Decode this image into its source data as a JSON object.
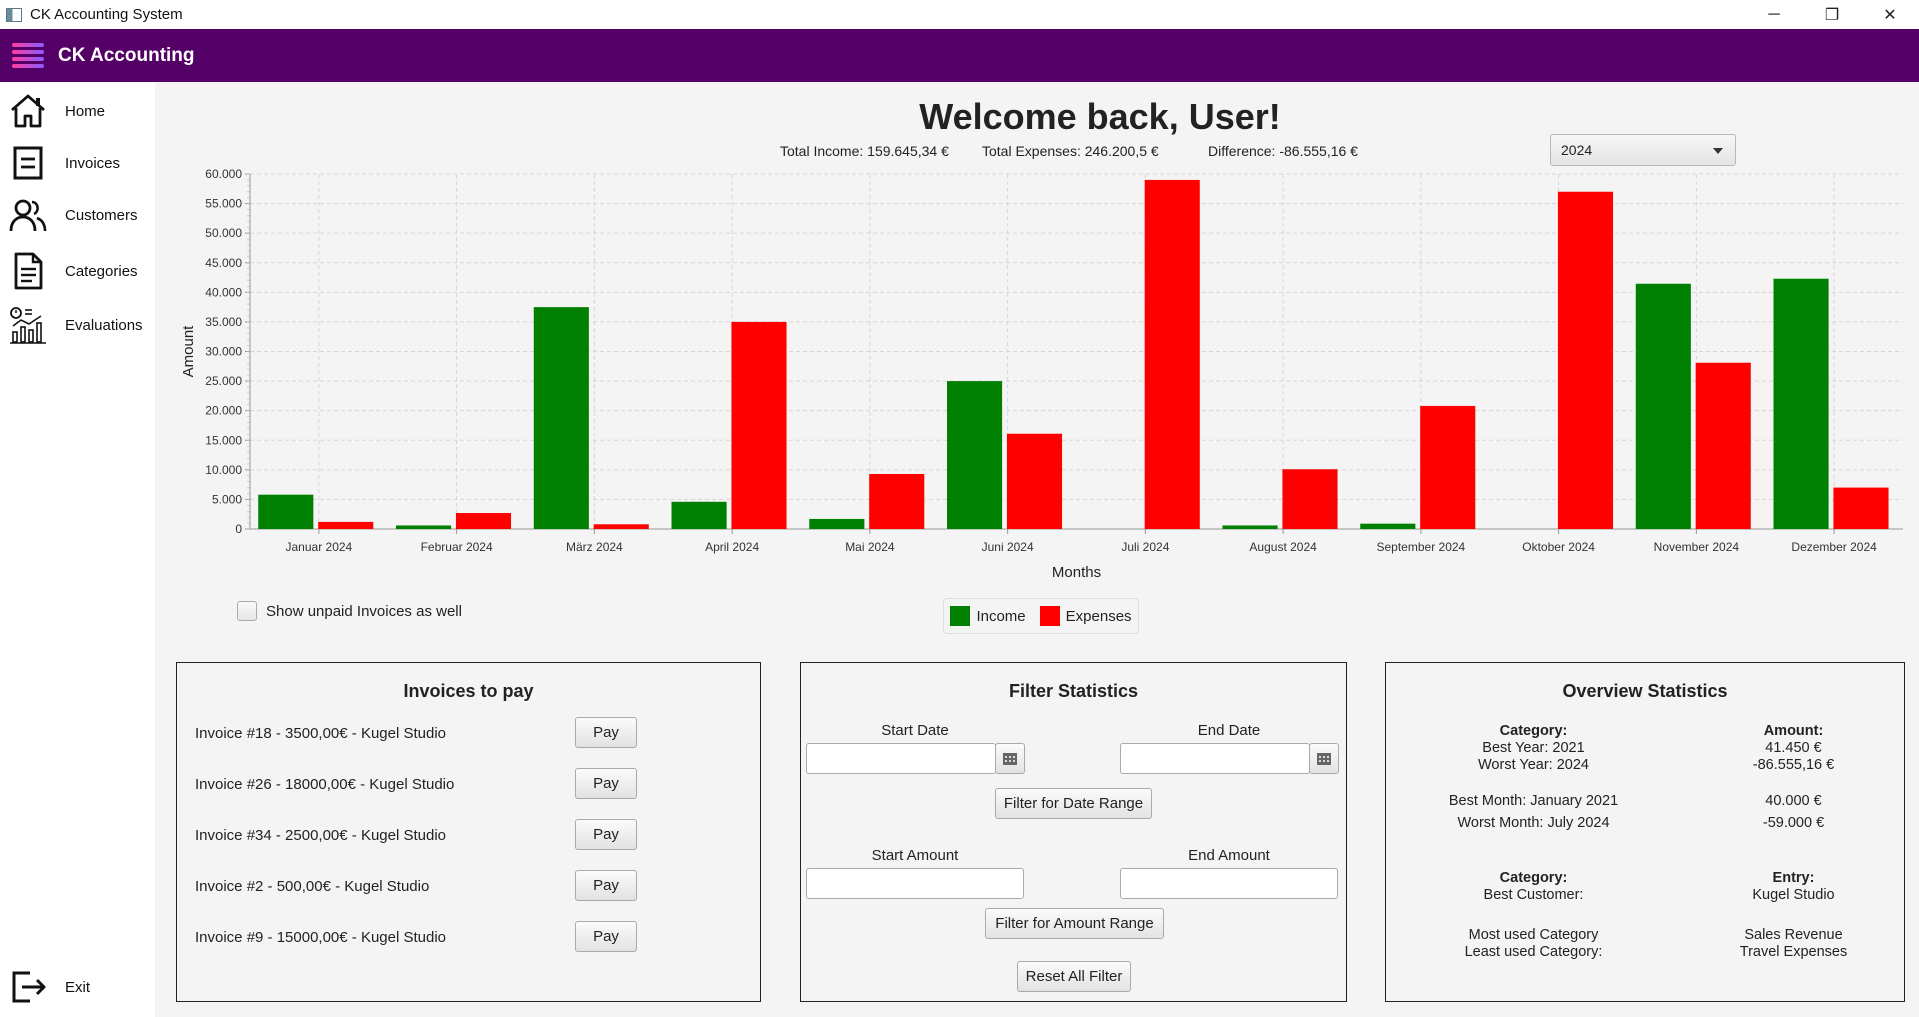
{
  "window": {
    "title": "CK Accounting System",
    "controls": [
      "─",
      "❐",
      "✕"
    ]
  },
  "app": {
    "brand": "CK Accounting"
  },
  "sidebar": {
    "items": [
      {
        "label": "Home",
        "icon": "home-icon"
      },
      {
        "label": "Invoices",
        "icon": "invoice-icon"
      },
      {
        "label": "Customers",
        "icon": "customers-icon"
      },
      {
        "label": "Categories",
        "icon": "document-icon"
      },
      {
        "label": "Evaluations",
        "icon": "evaluation-chart-icon"
      }
    ],
    "exit_label": "Exit",
    "exit_icon": "exit-icon"
  },
  "header": {
    "welcome": "Welcome back, User!",
    "total_income": "Total Income: 159.645,34 €",
    "total_expenses": "Total Expenses: 246.200,5 €",
    "difference": "Difference: -86.555,16 €",
    "year_selected": "2024"
  },
  "chart_data": {
    "type": "bar",
    "xlabel": "Months",
    "ylabel": "Amount",
    "ylim": [
      0,
      60000
    ],
    "ytick_labels": [
      "0",
      "5.000",
      "10.000",
      "15.000",
      "20.000",
      "25.000",
      "30.000",
      "35.000",
      "40.000",
      "45.000",
      "50.000",
      "55.000",
      "60.000"
    ],
    "categories": [
      "Januar 2024",
      "Februar 2024",
      "März 2024",
      "April 2024",
      "Mai 2024",
      "Juni 2024",
      "Juli 2024",
      "August 2024",
      "September 2024",
      "Oktober 2024",
      "November 2024",
      "Dezember 2024"
    ],
    "series": [
      {
        "name": "Income",
        "color": "#008000",
        "values": [
          5800,
          600,
          37500,
          4600,
          1700,
          25000,
          0,
          600,
          900,
          0,
          41450,
          42300
        ]
      },
      {
        "name": "Expenses",
        "color": "#ff0000",
        "values": [
          1200,
          2700,
          800,
          35000,
          9300,
          16100,
          59000,
          10100,
          20800,
          57000,
          28100,
          7000
        ]
      }
    ],
    "grid": true,
    "legend": "bottom-center"
  },
  "filters": {
    "unpaid_checkbox_label": "Show unpaid Invoices as well"
  },
  "invoices_panel": {
    "title": "Invoices to pay",
    "pay_label": "Pay",
    "items": [
      "Invoice #18 - 3500,00€ - Kugel Studio",
      "Invoice #26 - 18000,00€ - Kugel Studio",
      "Invoice #34 - 2500,00€ - Kugel Studio",
      "Invoice #2 - 500,00€ - Kugel Studio",
      "Invoice #9 - 15000,00€ - Kugel Studio"
    ]
  },
  "filter_panel": {
    "title": "Filter Statistics",
    "start_date_label": "Start Date",
    "end_date_label": "End Date",
    "start_date_value": "",
    "end_date_value": "",
    "date_button": "Filter for Date Range",
    "start_amount_label": "Start Amount",
    "end_amount_label": "End Amount",
    "start_amount_value": "",
    "end_amount_value": "",
    "amount_button": "Filter for Amount Range",
    "reset_button": "Reset All Filter"
  },
  "overview_panel": {
    "title": "Overview Statistics",
    "category_header": "Category:",
    "amount_header": "Amount:",
    "best_year": "Best Year: 2021",
    "best_year_amount": "41.450 €",
    "worst_year": "Worst Year: 2024",
    "worst_year_amount": "-86.555,16 €",
    "best_month": "Best Month: January 2021",
    "best_month_amount": "40.000 €",
    "worst_month": "Worst Month: July 2024",
    "worst_month_amount": "-59.000 €",
    "category_header2": "Category:",
    "entry_header": "Entry:",
    "best_customer": "Best Customer:",
    "best_customer_value": "Kugel Studio",
    "most_used": "Most used Category",
    "most_used_value": "Sales Revenue",
    "least_used": "Least used Category:",
    "least_used_value": "Travel Expenses"
  }
}
